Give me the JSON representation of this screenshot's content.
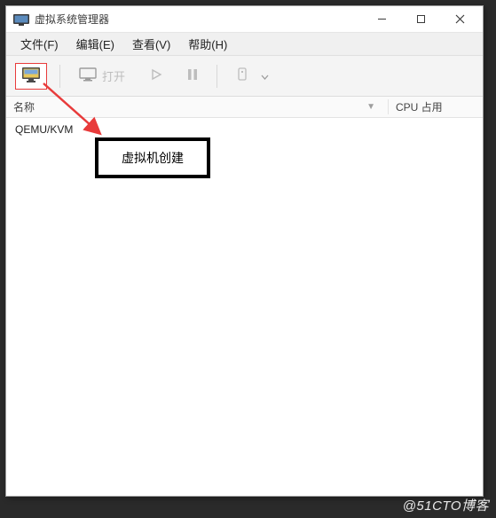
{
  "titlebar": {
    "title": "虚拟系统管理器",
    "min_tip": "最小化",
    "max_tip": "最大化",
    "close_tip": "关闭"
  },
  "menu": {
    "file": "文件(F)",
    "edit": "编辑(E)",
    "view": "查看(V)",
    "help": "帮助(H)"
  },
  "toolbar": {
    "new_tip": "创建新虚拟机",
    "open_label": "打开",
    "run_tip": "运行",
    "pause_tip": "暂停",
    "shutdown_tip": "关机"
  },
  "columns": {
    "name": "名称",
    "cpu": "CPU 占用"
  },
  "rows": {
    "r0": {
      "name": "QEMU/KVM"
    }
  },
  "annotation": {
    "callout": "虚拟机创建"
  },
  "watermark": "@51CTO博客"
}
